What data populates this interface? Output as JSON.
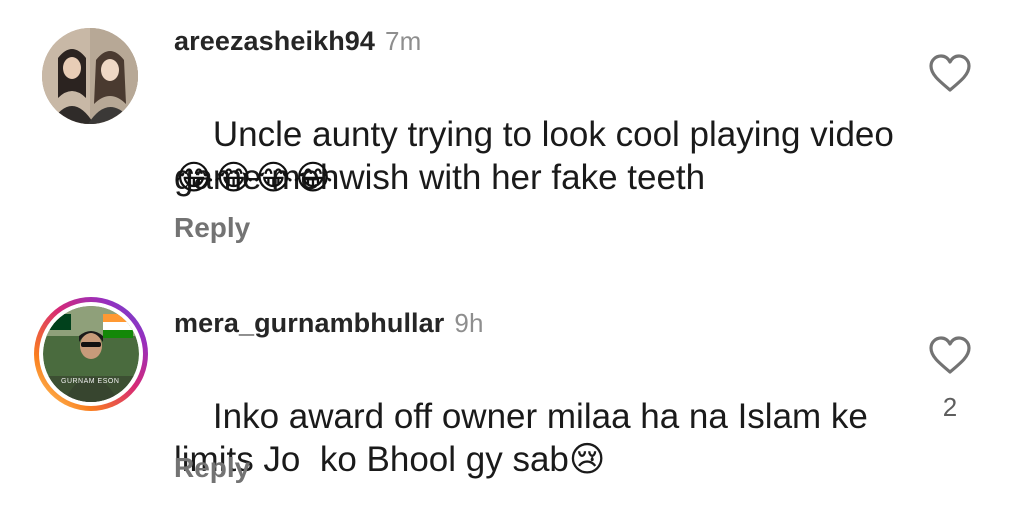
{
  "comments": [
    {
      "username": "areezasheikh94",
      "time": "7m",
      "text": "Uncle aunty trying to look cool playing video game mehwish with her fake teeth",
      "emojis": "😂😂😂😂",
      "reply_label": "Reply",
      "avatar_icon": "profile-photo"
    },
    {
      "username": "mera_gurnambhullar",
      "time": "9h",
      "text": "Inko award off owner milaa ha na Islam ke limits Jo  ko Bhool gy sab😢",
      "reply_label": "Reply",
      "like_count": "2",
      "avatar_icon": "profile-photo-story-ring",
      "avatar_caption": "GURNAM ESON"
    }
  ],
  "colors": {
    "story_ring": "#d62976",
    "secondary_text": "#8e8e8e",
    "reply_text": "#737373"
  }
}
